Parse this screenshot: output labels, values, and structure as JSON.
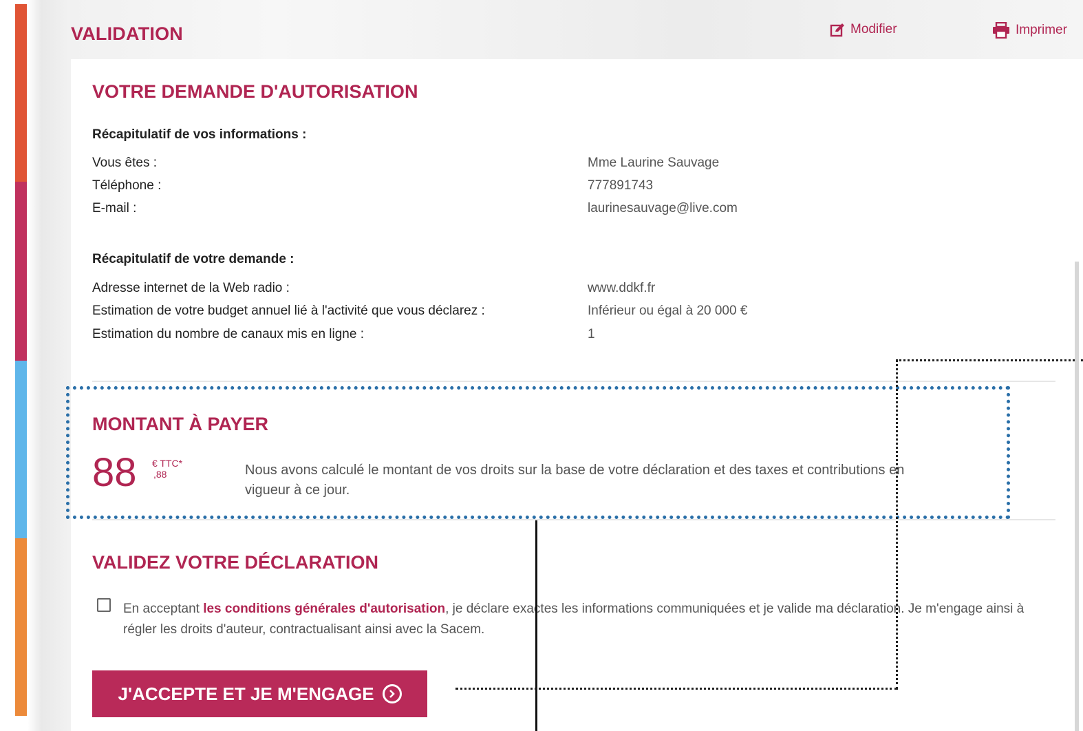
{
  "header": {
    "title": "VALIDATION",
    "edit_label": "Modifier",
    "print_label": "Imprimer"
  },
  "demande": {
    "title": "VOTRE DEMANDE D'AUTORISATION",
    "infos_heading": "Récapitulatif de vos informations :",
    "infos": [
      {
        "label": "Vous êtes :",
        "value": "Mme Laurine Sauvage"
      },
      {
        "label": "Téléphone :",
        "value": "777891743"
      },
      {
        "label": "E-mail :",
        "value": "laurinesauvage@live.com"
      }
    ],
    "request_heading": "Récapitulatif de votre demande :",
    "request": [
      {
        "label": "Adresse internet de la Web radio :",
        "value": "www.ddkf.fr"
      },
      {
        "label": "Estimation de votre budget annuel lié à l'activité que vous déclarez :",
        "value": "Inférieur ou égal à 20 000 €"
      },
      {
        "label": "Estimation du nombre de canaux mis en ligne :",
        "value": "1"
      }
    ]
  },
  "montant": {
    "title": "MONTANT À PAYER",
    "amount": "88",
    "currency": "€ TTC*",
    "decimals": ",88",
    "note": "Nous avons calculé le montant de vos droits sur la base de votre déclaration et des taxes et contributions en vigueur à ce jour."
  },
  "validation": {
    "title": "VALIDEZ VOTRE DÉCLARATION",
    "consent_prefix": "En acceptant ",
    "consent_link": "les conditions générales d'autorisation",
    "consent_suffix": ", je déclare exactes les informations communiquées et je valide ma déclaration. Je m'engage ainsi à régler les droits d'auteur, contractualisant ainsi avec la Sacem.",
    "checked": false,
    "button_label": "J'ACCEPTE ET JE M'ENGAGE"
  },
  "colors": {
    "accent": "#b02552",
    "button": "#b92a59",
    "bar_red": "#e05435",
    "bar_magenta": "#c0315e",
    "bar_blue": "#5fb6ea",
    "bar_orange": "#ec8a3a",
    "annotation_blue": "#2a6fa8"
  }
}
